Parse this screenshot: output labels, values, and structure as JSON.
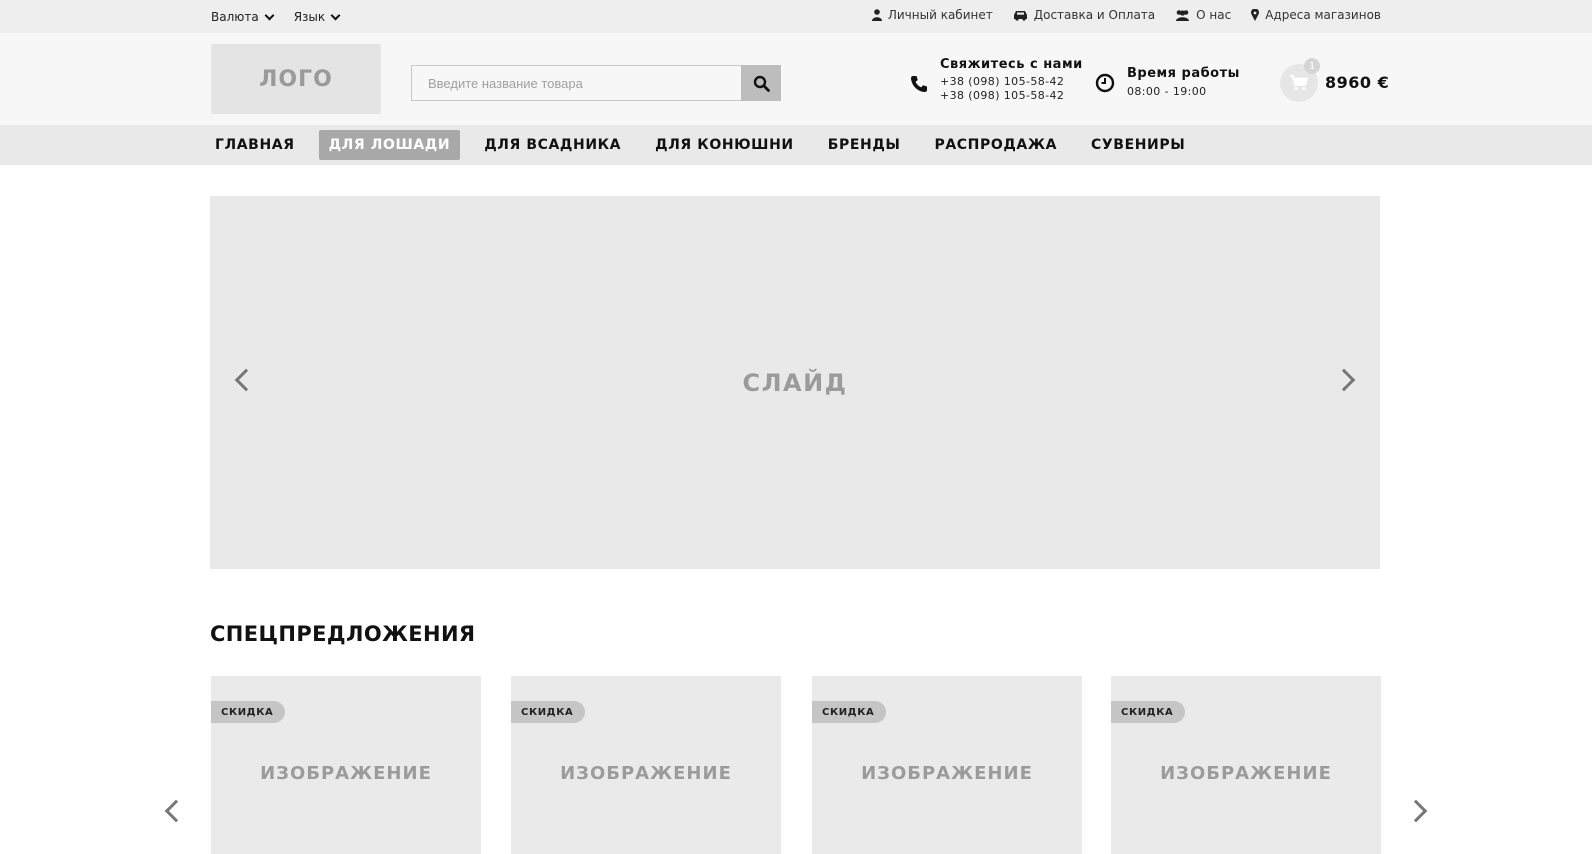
{
  "topbar": {
    "currency_label": "Валюта",
    "language_label": "Язык",
    "links": {
      "account": "Личный кабинет",
      "delivery": "Доставка и Оплата",
      "about": "О нас",
      "stores": "Адреса магазинов"
    },
    "icons": {
      "account": "user-icon",
      "delivery": "car-icon",
      "about": "users-icon",
      "stores": "map-marker-icon"
    }
  },
  "header": {
    "logo_text": "ЛОГО",
    "search": {
      "placeholder": "Введите название товара",
      "value": ""
    },
    "contact": {
      "title": "Свяжитесь с нами",
      "phone1": "+38 (098) 105-58-42",
      "phone2": "+38 (098) 105-58-42"
    },
    "hours": {
      "title": "Время работы",
      "value": "08:00 - 19:00"
    },
    "cart": {
      "count": "1",
      "total": "8960 €"
    }
  },
  "nav": {
    "items": [
      {
        "label": "ГЛАВНАЯ",
        "active": false
      },
      {
        "label": "ДЛЯ ЛОШАДИ",
        "active": true
      },
      {
        "label": "ДЛЯ ВСАДНИКА",
        "active": false
      },
      {
        "label": "ДЛЯ КОНЮШНИ",
        "active": false
      },
      {
        "label": "БРЕНДЫ",
        "active": false
      },
      {
        "label": "РАСПРОДАЖА",
        "active": false
      },
      {
        "label": "СУВЕНИРЫ",
        "active": false
      }
    ]
  },
  "slider": {
    "text": "СЛАЙД"
  },
  "specials": {
    "title": "СПЕЦПРЕДЛОЖЕНИЯ",
    "cards": [
      {
        "tag": "СКИДКА",
        "image_text": "ИЗОБРАЖЕНИЕ"
      },
      {
        "tag": "СКИДКА",
        "image_text": "ИЗОБРАЖЕНИЕ"
      },
      {
        "tag": "СКИДКА",
        "image_text": "ИЗОБРАЖЕНИЕ"
      },
      {
        "tag": "СКИДКА",
        "image_text": "ИЗОБРАЖЕНИЕ"
      }
    ]
  },
  "colors": {
    "active_nav": "#a8a8a8",
    "topbar_bg": "#efeeef",
    "placeholder_bg": "#e9e9e9"
  }
}
